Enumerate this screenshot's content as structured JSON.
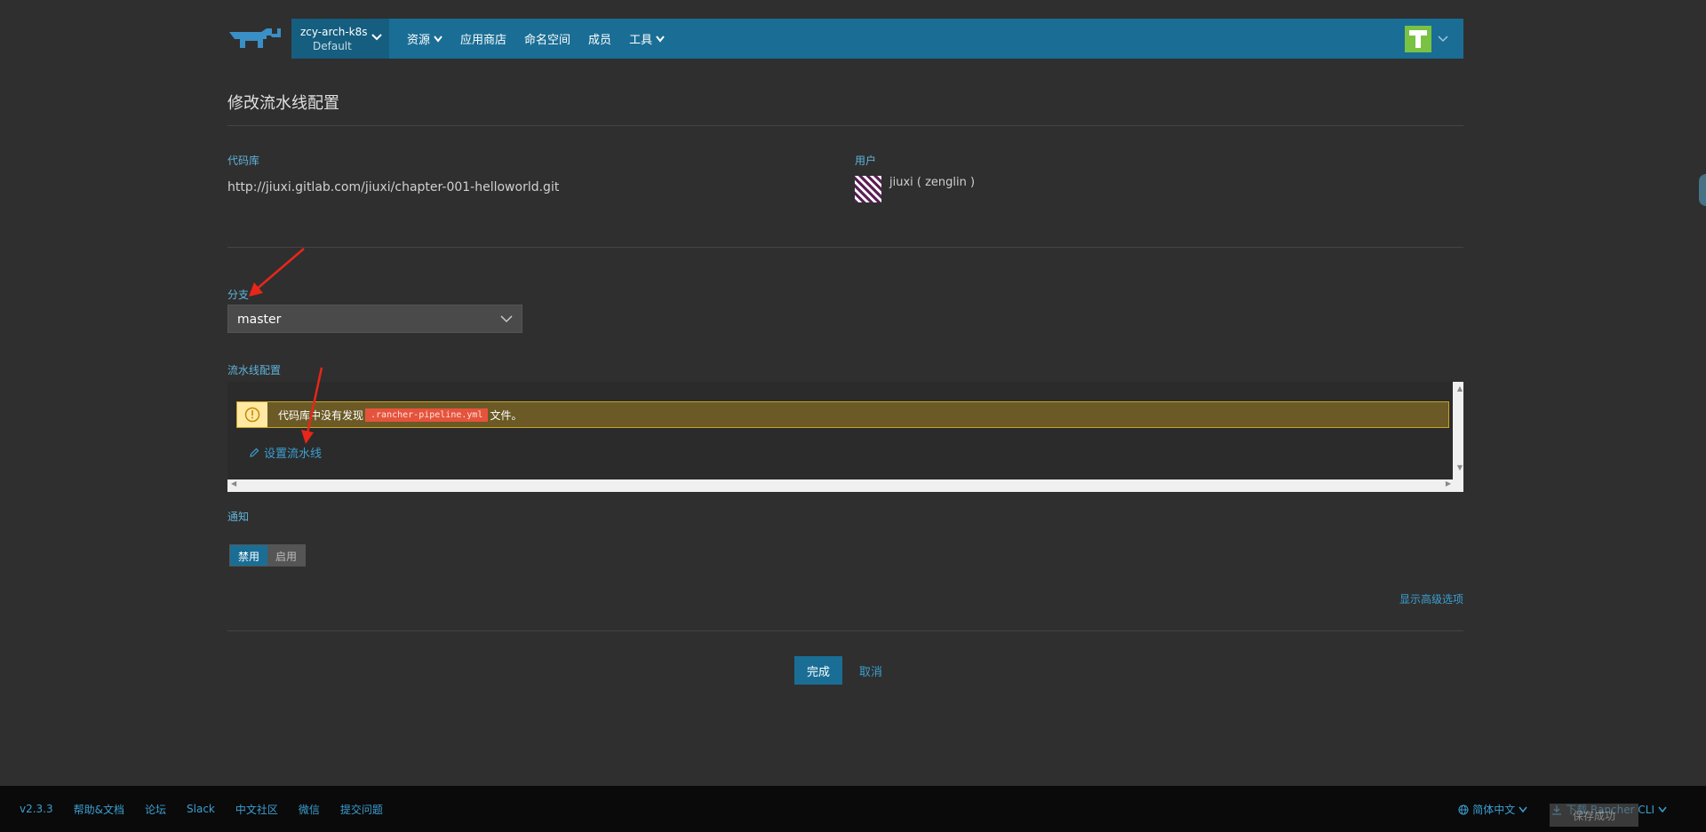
{
  "header": {
    "cluster_name": "zcy-arch-k8s",
    "project_name": "Default",
    "nav": [
      "资源",
      "应用商店",
      "命名空间",
      "成员",
      "工具"
    ]
  },
  "page": {
    "title": "修改流水线配置",
    "repo_label": "代码库",
    "repo_url": "http://jiuxi.gitlab.com/jiuxi/chapter-001-helloworld.git",
    "user_label": "用户",
    "user_name": "jiuxi ( zenglin )",
    "branch_label": "分支",
    "branch_value": "master",
    "pipeline_label": "流水线配置",
    "warning_prefix": "代码库中没有发现",
    "warning_file": ".rancher-pipeline.yml",
    "warning_suffix": "文件。",
    "setup_link": "设置流水线",
    "notify_label": "通知",
    "notify_off": "禁用",
    "notify_on": "启用",
    "advanced_link": "显示高级选项",
    "done_button": "完成",
    "cancel_button": "取消"
  },
  "footer": {
    "version": "v2.3.3",
    "links": [
      "帮助&文档",
      "论坛",
      "Slack",
      "中文社区",
      "微信",
      "提交问题"
    ],
    "language": "简体中文",
    "cli": "下载 Rancher CLI",
    "toast": "保存成功"
  },
  "colors": {
    "nav_bg": "#1a6e95",
    "accent": "#3b9fd1",
    "warning_bg": "#6b5a26",
    "code_tag": "#e6533c",
    "annotation_arrow": "#e8261a"
  }
}
